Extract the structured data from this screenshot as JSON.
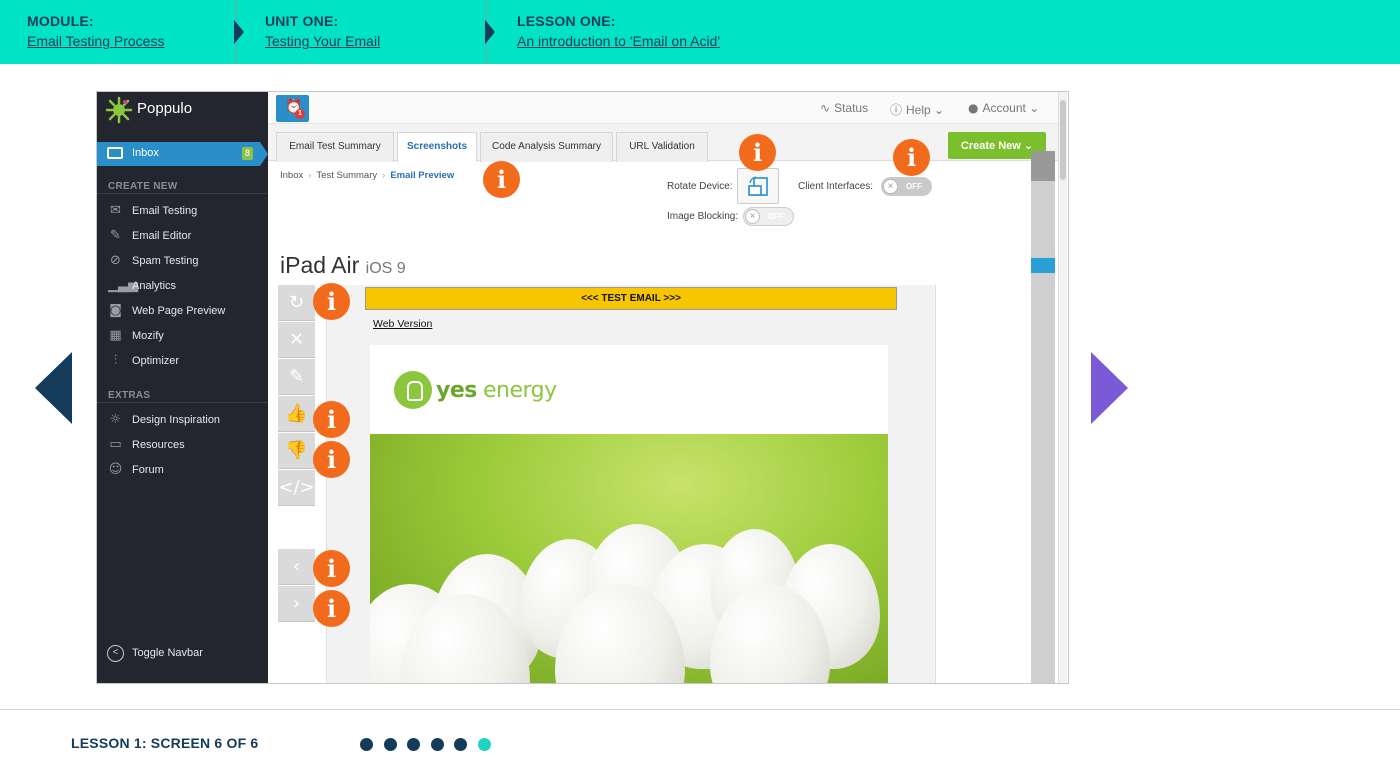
{
  "header": {
    "module": {
      "label": "MODULE:",
      "value": "Email Testing Process"
    },
    "unit": {
      "label": "UNIT ONE:",
      "value": "Testing Your Email"
    },
    "lesson": {
      "label": "LESSON ONE:",
      "value": "An introduction to 'Email on Acid'"
    }
  },
  "app": {
    "brand": "Poppulo",
    "inbox": {
      "label": "Inbox",
      "badge": "8"
    },
    "sections": {
      "create_new": "CREATE NEW",
      "extras": "EXTRAS"
    },
    "create_items": [
      {
        "label": "Email Testing",
        "icon": "envelope-icon"
      },
      {
        "label": "Email Editor",
        "icon": "edit-icon"
      },
      {
        "label": "Spam Testing",
        "icon": "ban-icon"
      },
      {
        "label": "Analytics",
        "icon": "bar-chart-icon"
      },
      {
        "label": "Web Page Preview",
        "icon": "camera-icon"
      },
      {
        "label": "Mozify",
        "icon": "grid-icon"
      },
      {
        "label": "Optimizer",
        "icon": "sliders-icon"
      }
    ],
    "extras_items": [
      {
        "label": "Design Inspiration",
        "icon": "lightbulb-icon"
      },
      {
        "label": "Resources",
        "icon": "folder-icon"
      },
      {
        "label": "Forum",
        "icon": "users-icon"
      }
    ],
    "toggle_navbar": "Toggle Navbar",
    "alarm_count": "1",
    "util": {
      "status": "Status",
      "help": "Help",
      "account": "Account"
    },
    "tabs": [
      {
        "label": "Email Test Summary",
        "active": false
      },
      {
        "label": "Screenshots",
        "active": true
      },
      {
        "label": "Code Analysis Summary",
        "active": false
      },
      {
        "label": "URL Validation",
        "active": false
      }
    ],
    "create_new_button": "Create New",
    "breadcrumb": [
      "Inbox",
      "Test Summary",
      "Email Preview"
    ],
    "controls": {
      "rotate_device": "Rotate Device:",
      "client_interfaces": "Client Interfaces:",
      "image_blocking": "Image Blocking:",
      "toggle_off": "OFF"
    },
    "device": {
      "name": "iPad Air",
      "os": "iOS 9"
    },
    "email": {
      "banner": "<<< TEST EMAIL >>>",
      "web_version": "Web Version",
      "brand_yes": "yes",
      "brand_energy": "energy"
    }
  },
  "footer": {
    "counter": "LESSON 1: SCREEN 6 OF 6",
    "total_screens": 6,
    "current_screen": 6
  },
  "colors": {
    "topbar": "#00e3c4",
    "navy": "#143c5a",
    "next_arrow": "#7a5ad6",
    "info_marker": "#f26a1b",
    "active_dot": "#1ed3c0"
  }
}
